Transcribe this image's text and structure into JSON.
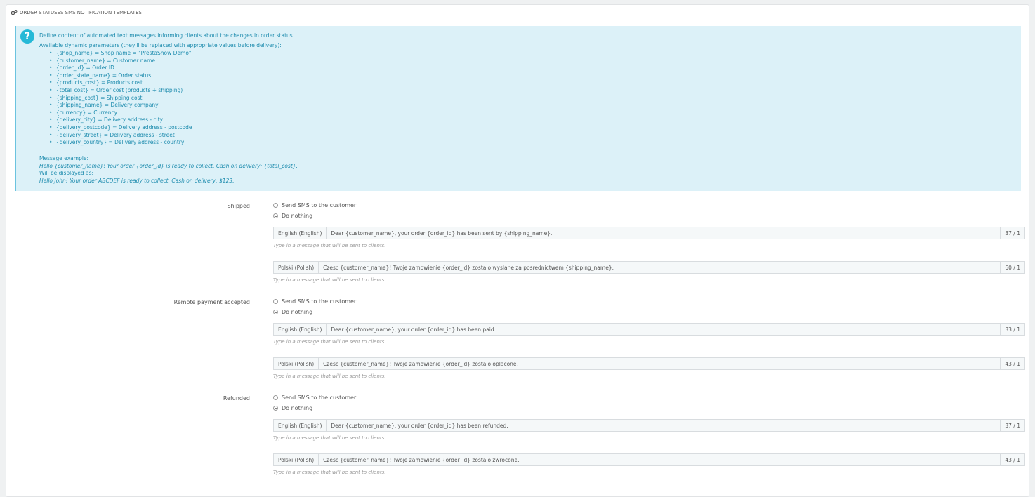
{
  "panel": {
    "title": "ORDER STATUSES SMS NOTIFICATION TEMPLATES",
    "icon": "gears-icon"
  },
  "info": {
    "icon": "question-icon",
    "intro": "Define content of automated text messages informing clients about the changes in order status.",
    "params_title": "Available dynamic parameters (they'll be replaced with appropriate values before delivery):",
    "params": [
      "{shop_name} = Shop name = \"PrestaShow Demo\"",
      "{customer_name} = Customer name",
      "{order_id} = Order ID",
      "{order_state_name} = Order status",
      "{products_cost} = Products cost",
      "{total_cost} = Order cost (products + shipping)",
      "{shipping_cost} = Shipping cost",
      "{shipping_name} = Delivery company",
      "{currency} = Currency",
      "{delivery_city} = Delivery address - city",
      "{delivery_postcode} = Delivery address - postcode",
      "{delivery_street} = Delivery address - street",
      "{delivery_country} = Delivery address - country"
    ],
    "example_title": "Message example:",
    "example": "Hello {customer_name}! Your order {order_id} is ready to collect. Cash on delivery: {total_cost}.",
    "displayed_as": "Will be displayed as:",
    "rendered": "Hello John! Your order ABCDEF is ready to collect. Cash on delivery: $123."
  },
  "options": {
    "send": "Send SMS to the customer",
    "nothing": "Do nothing"
  },
  "help_text": "Type in a message that will be sent to clients.",
  "statuses": [
    {
      "label": "Shipped",
      "selected": "nothing",
      "messages": [
        {
          "lang": "English (English)",
          "text": "Dear {customer_name}, your order {order_id} has been sent by {shipping_name}.",
          "count": "37 / 1"
        },
        {
          "lang": "Polski (Polish)",
          "text": "Czesc {customer_name}! Twoje zamowienie {order_id} zostalo wyslane za posrednictwem {shipping_name}.",
          "count": "60 / 1"
        }
      ]
    },
    {
      "label": "Remote payment accepted",
      "selected": "nothing",
      "messages": [
        {
          "lang": "English (English)",
          "text": "Dear {customer_name}, your order {order_id} has been paid.",
          "count": "33 / 1"
        },
        {
          "lang": "Polski (Polish)",
          "text": "Czesc {customer_name}! Twoje zamowienie {order_id} zostalo oplacone.",
          "count": "43 / 1"
        }
      ]
    },
    {
      "label": "Refunded",
      "selected": "nothing",
      "messages": [
        {
          "lang": "English (English)",
          "text": "Dear {customer_name}, your order {order_id} has been refunded.",
          "count": "37 / 1"
        },
        {
          "lang": "Polski (Polish)",
          "text": "Czesc {customer_name}! Twoje zamowienie {order_id} zostalo zwrocone.",
          "count": "43 / 1"
        }
      ]
    }
  ]
}
